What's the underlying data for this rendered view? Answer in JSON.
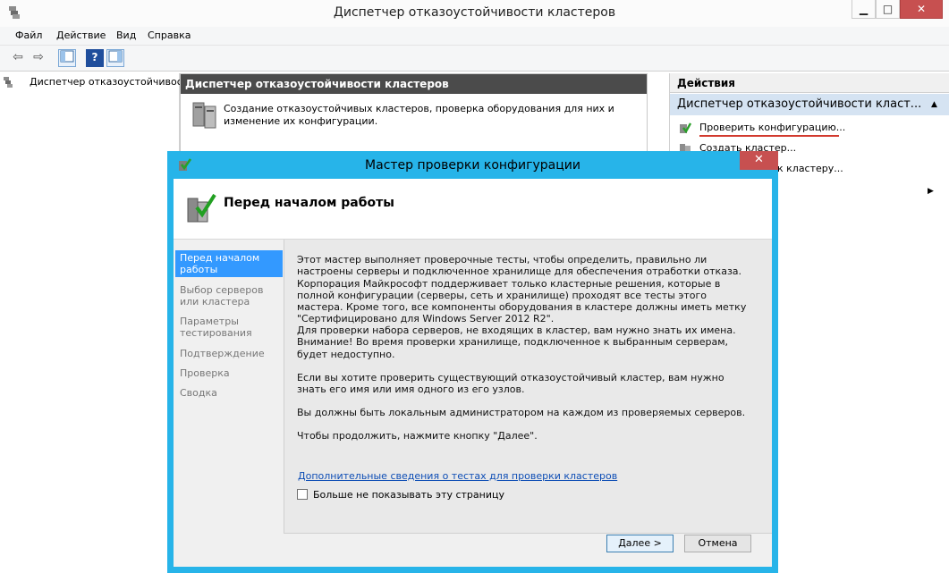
{
  "window": {
    "title": "Диспетчер отказоустойчивости кластеров",
    "controls": [
      "▁",
      "□",
      "✕"
    ]
  },
  "menu": [
    "Файл",
    "Действие",
    "Вид",
    "Справка"
  ],
  "toolbar": {
    "back_icon": "back-arrow-icon",
    "forward_icon": "forward-arrow-icon",
    "show_tree_icon": "console-tree-icon",
    "help_icon": "help-icon",
    "action_pane_icon": "action-pane-icon"
  },
  "tree": {
    "root": "Диспетчер отказоустойчивос"
  },
  "center": {
    "header": "Диспетчер отказоустойчивости кластеров",
    "description": "Создание отказоустойчивых кластеров, проверка оборудования для них и изменение их конфигурации."
  },
  "actions": {
    "header": "Действия",
    "section": "Диспетчер отказоустойчивости класт...",
    "collapse": "▲",
    "items": [
      {
        "label": "Проверить конфигурацию..."
      },
      {
        "label": "Создать кластер..."
      },
      {
        "label": "к кластеру..."
      }
    ]
  },
  "dialog": {
    "title": "Мастер проверки конфигурации",
    "close": "✕",
    "heading": "Перед началом работы",
    "steps": [
      "Перед началом работы",
      "Выбор серверов или кластера",
      "Параметры тестирования",
      "Подтверждение",
      "Проверка",
      "Сводка"
    ],
    "paragraphs": [
      "Этот мастер выполняет проверочные тесты, чтобы определить, правильно ли настроены серверы и подключенное хранилище для обеспечения отработки отказа. Корпорация Майкрософт поддерживает только кластерные решения, которые в полной конфигурации (серверы, сеть и хранилище) проходят все тесты этого мастера. Кроме того, все компоненты оборудования в кластере должны иметь метку \"Сертифицировано для Windows Server 2012 R2\".",
      "Для проверки набора серверов, не входящих в кластер, вам нужно знать их имена. Внимание! Во время проверки хранилище, подключенное к выбранным серверам, будет недоступно.",
      "Если вы хотите проверить существующий отказоустойчивый кластер, вам нужно знать его имя или имя одного из его узлов.",
      "Вы должны быть локальным администратором на каждом из проверяемых серверов.",
      "Чтобы продолжить, нажмите кнопку \"Далее\"."
    ],
    "link": "Дополнительные сведения о тестах для проверки кластеров",
    "checkbox_label": "Больше не показывать эту страницу",
    "checkbox_checked": false,
    "next": "Далее >",
    "cancel": "Отмена"
  }
}
